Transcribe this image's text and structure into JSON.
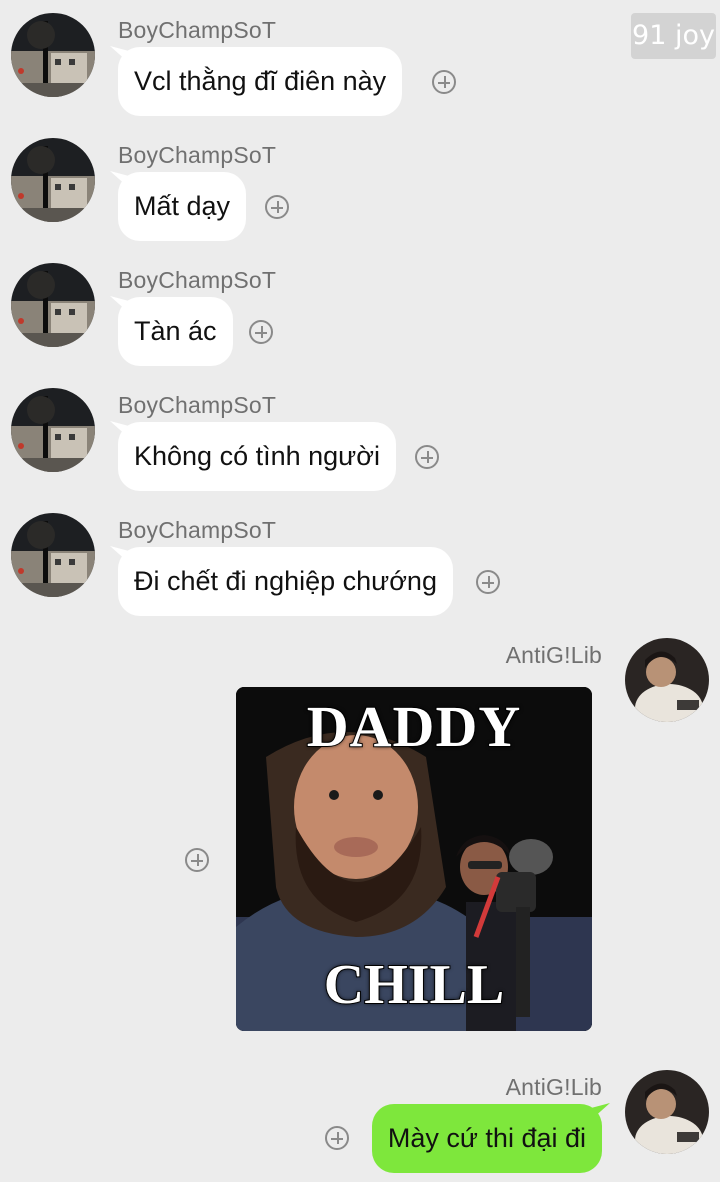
{
  "watermark": "91 joy",
  "contact_name": "BoyChampSoT",
  "self_name": "AntiG!Lib",
  "messages_in": [
    "Vcl thằng đĩ điên này",
    "Mất dạy",
    "Tàn ác",
    "Không có tình người",
    "Đi chết đi nghiệp chướng"
  ],
  "sticker": {
    "top_text": "DADDY",
    "bottom_text": "CHILL"
  },
  "message_out": "Mày cứ thi đại đi",
  "colors": {
    "background": "#ececec",
    "bubble_in": "#ffffff",
    "bubble_out": "#7ee73c"
  }
}
